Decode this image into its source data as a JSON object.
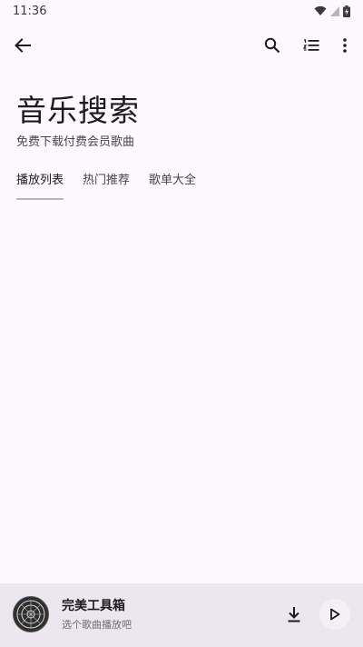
{
  "status_bar": {
    "time": "11:36"
  },
  "toolbar": {
    "icons": [
      "arrow-left-icon",
      "search-icon",
      "playlist-icon",
      "more-vert-icon"
    ]
  },
  "header": {
    "title": "音乐搜索",
    "subtitle": "免费下载付费会员歌曲"
  },
  "tabs": [
    {
      "label": "播放列表",
      "active": true
    },
    {
      "label": "热门推荐",
      "active": false
    },
    {
      "label": "歌单大全",
      "active": false
    }
  ],
  "player": {
    "title": "完美工具箱",
    "subtitle": "选个歌曲播放吧"
  },
  "colors": {
    "background": "#fdf8fd",
    "player_background": "#ece7ee",
    "tab_indicator": "#b8b4bc",
    "text_primary": "#1c1b1f",
    "text_secondary": "#49454f"
  }
}
